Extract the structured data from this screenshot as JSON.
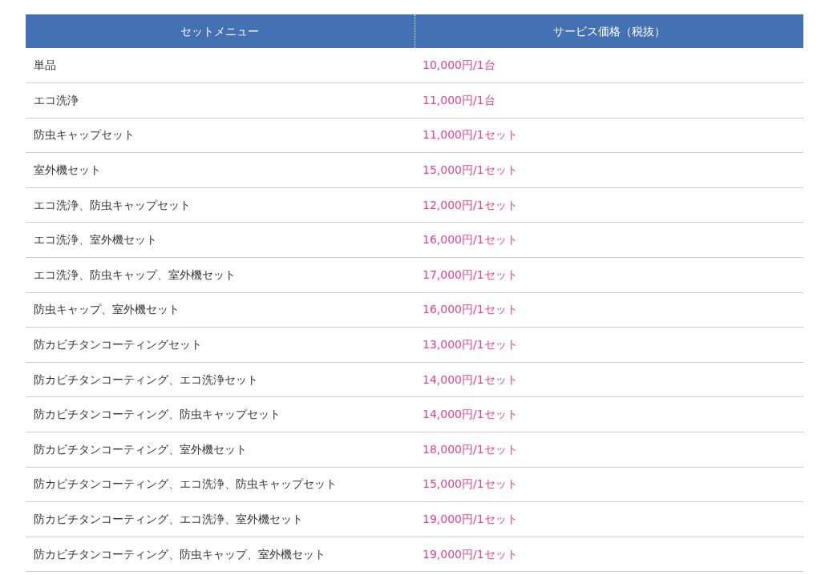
{
  "table": {
    "columns": [
      "セットメニュー",
      "サービス価格（税抜）"
    ],
    "rows": [
      [
        "単品",
        "10,000円/1台"
      ],
      [
        "エコ洗浄",
        "11,000円/1台"
      ],
      [
        "防虫キャップセット",
        "11,000円/1セット"
      ],
      [
        "室外機セット",
        "15,000円/1セット"
      ],
      [
        "エコ洗浄、防虫キャップセット",
        "12,000円/1セット"
      ],
      [
        "エコ洗浄、室外機セット",
        "16,000円/1セット"
      ],
      [
        "エコ洗浄、防虫キャップ、室外機セット",
        "17,000円/1セット"
      ],
      [
        "防虫キャップ、室外機セット",
        "16,000円/1セット"
      ],
      [
        "防カビチタンコーティングセット",
        "13,000円/1セット"
      ],
      [
        "防カビチタンコーティング、エコ洗浄セット",
        "14,000円/1セット"
      ],
      [
        "防カビチタンコーティング、防虫キャップセット",
        "14,000円/1セット"
      ],
      [
        "防カビチタンコーティング、室外機セット",
        "18,000円/1セット"
      ],
      [
        "防カビチタンコーティング、エコ洗浄、防虫キャップセット",
        "15,000円/1セット"
      ],
      [
        "防カビチタンコーティング、エコ洗浄、室外機セット",
        "19,000円/1セット"
      ],
      [
        "防カビチタンコーティング、防虫キャップ、室外機セット",
        "19,000円/1セット"
      ]
    ]
  }
}
